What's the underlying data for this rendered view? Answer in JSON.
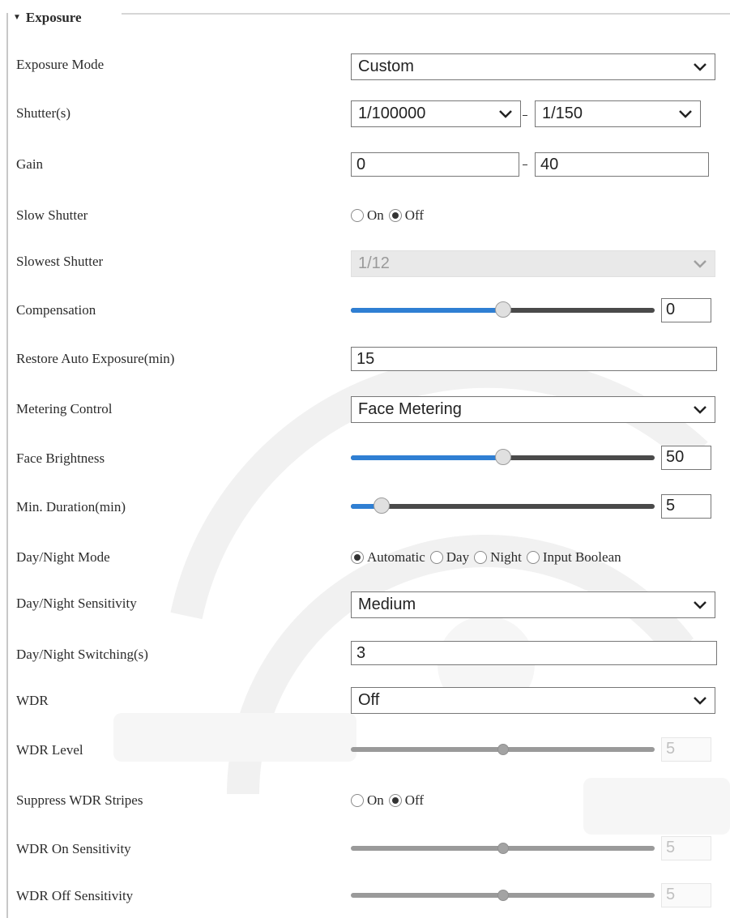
{
  "section": {
    "title": "Exposure"
  },
  "exposure_mode": {
    "label": "Exposure Mode",
    "value": "Custom"
  },
  "shutter": {
    "label": "Shutter(s)",
    "min": "1/100000",
    "max": "1/150"
  },
  "gain": {
    "label": "Gain",
    "min": "0",
    "max": "40"
  },
  "slow_shutter": {
    "label": "Slow Shutter",
    "options": [
      "On",
      "Off"
    ],
    "selected": "Off"
  },
  "slowest_shutter": {
    "label": "Slowest Shutter",
    "value": "1/12"
  },
  "compensation": {
    "label": "Compensation",
    "value": "0",
    "level": 0.5
  },
  "restore_auto_exposure": {
    "label": "Restore Auto Exposure(min)",
    "value": "15"
  },
  "metering_control": {
    "label": "Metering Control",
    "value": "Face Metering"
  },
  "face_brightness": {
    "label": "Face Brightness",
    "value": "50",
    "level": 0.5
  },
  "min_duration": {
    "label": "Min. Duration(min)",
    "value": "5",
    "level": 0.1
  },
  "day_night_mode": {
    "label": "Day/Night Mode",
    "options": [
      "Automatic",
      "Day",
      "Night",
      "Input Boolean"
    ],
    "selected": "Automatic"
  },
  "day_night_sensitivity": {
    "label": "Day/Night Sensitivity",
    "value": "Medium"
  },
  "day_night_switching": {
    "label": "Day/Night Switching(s)",
    "value": "3"
  },
  "wdr": {
    "label": "WDR",
    "value": "Off"
  },
  "wdr_level": {
    "label": "WDR Level",
    "value": "5",
    "level": 0.5
  },
  "suppress_wdr_stripes": {
    "label": "Suppress WDR Stripes",
    "options": [
      "On",
      "Off"
    ],
    "selected": "Off"
  },
  "wdr_on_sensitivity": {
    "label": "WDR On Sensitivity",
    "value": "5",
    "level": 0.5
  },
  "wdr_off_sensitivity": {
    "label": "WDR Off Sensitivity",
    "value": "5",
    "level": 0.5
  },
  "colors": {
    "slider_fill": "#2f7fd3",
    "slider_track": "#4a4a4a",
    "slider_track_disabled": "#9a9a9a"
  },
  "icons": {
    "section_toggle": "caret-down-icon",
    "dropdown": "chevron-down-icon"
  }
}
